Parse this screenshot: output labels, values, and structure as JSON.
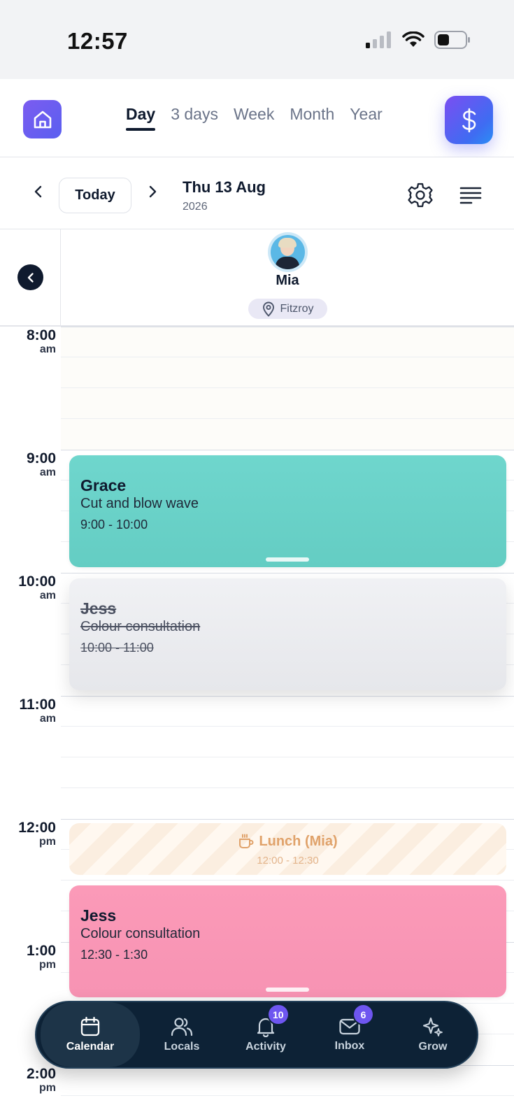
{
  "status_bar": {
    "time": "12:57"
  },
  "view_tabs": [
    {
      "label": "Day",
      "active": true
    },
    {
      "label": "3 days",
      "active": false
    },
    {
      "label": "Week",
      "active": false
    },
    {
      "label": "Month",
      "active": false
    },
    {
      "label": "Year",
      "active": false
    }
  ],
  "date_bar": {
    "today_label": "Today",
    "date": "Thu 13 Aug",
    "year": "2026"
  },
  "staff": {
    "name": "Mia",
    "location": "Fitzroy"
  },
  "time_labels": [
    {
      "time": "8:00",
      "period": "am"
    },
    {
      "time": "9:00",
      "period": "am"
    },
    {
      "time": "10:00",
      "period": "am"
    },
    {
      "time": "11:00",
      "period": "am"
    },
    {
      "time": "12:00",
      "period": "pm"
    },
    {
      "time": "1:00",
      "period": "pm"
    },
    {
      "time": "2:00",
      "period": "pm"
    }
  ],
  "appointments": [
    {
      "client": "Grace",
      "service": "Cut and blow wave",
      "time": "9:00 - 10:00",
      "color": "#6fd6cd",
      "cancelled": false
    },
    {
      "client": "Jess",
      "service": "Colour consultation",
      "time": "10:00 - 11:00",
      "color": "#ececef",
      "cancelled": true
    },
    {
      "client": "Jess",
      "service": "Colour consultation",
      "time": "12:30 - 1:30",
      "color": "#fb9ab8",
      "cancelled": false
    }
  ],
  "break": {
    "title": "Lunch (Mia)",
    "time": "12:00 - 12:30",
    "color": "#e0a26a"
  },
  "bottom_nav": [
    {
      "label": "Calendar",
      "icon": "calendar-icon",
      "active": true
    },
    {
      "label": "Locals",
      "icon": "users-icon",
      "active": false
    },
    {
      "label": "Activity",
      "icon": "bell-icon",
      "badge": "10",
      "active": false
    },
    {
      "label": "Inbox",
      "icon": "mail-icon",
      "badge": "6",
      "active": false
    },
    {
      "label": "Grow",
      "icon": "sparkle-icon",
      "active": false
    }
  ],
  "colors": {
    "accent": "#6e56f0",
    "nav_bg": "#0d2236",
    "text": "#0f1a2e"
  }
}
